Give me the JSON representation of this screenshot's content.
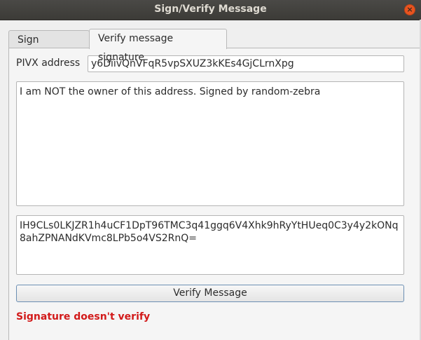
{
  "window": {
    "title": "Sign/Verify Message",
    "close_glyph": "×"
  },
  "tabs": [
    {
      "label": "Sign message",
      "active": false
    },
    {
      "label": "Verify message signature",
      "active": true
    }
  ],
  "verify": {
    "address_label": "PIVX address",
    "address_value": "y6DiivQnVFqR5vpSXUZ3kKEs4GjCLrnXpg",
    "message_value": "I am NOT the owner of this address. Signed by random-zebra",
    "signature_value": "IH9CLs0LKJZR1h4uCF1DpT96TMC3q41ggq6V4Xhk9hRyYtHUeq0C3y4y2kONq8ahZPNANdKVmc8LPb5o4VS2RnQ=",
    "button_label": "Verify Message",
    "status_text": "Signature doesn't verify"
  },
  "colors": {
    "status_error": "#d21a1a",
    "titlebar": "#3c3b37",
    "close_button": "#e9541f"
  }
}
